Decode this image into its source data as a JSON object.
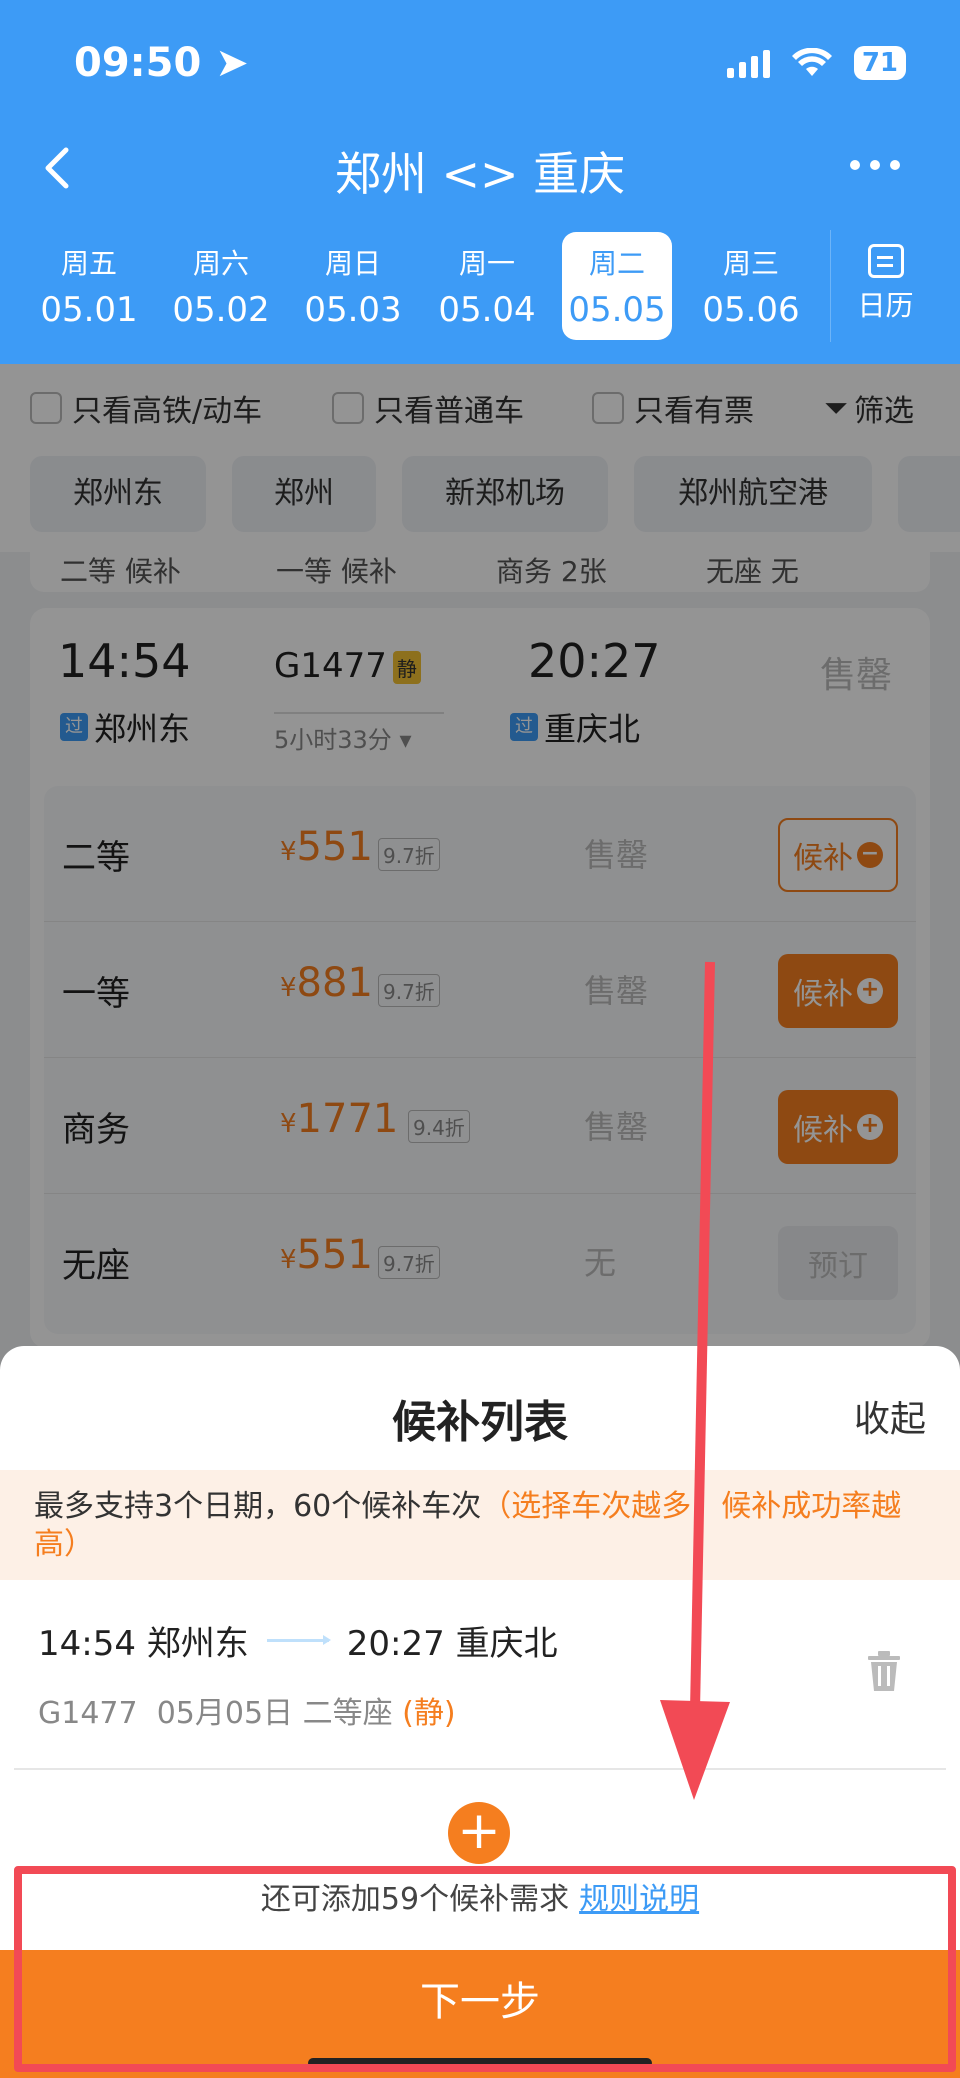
{
  "status_bar": {
    "time": "09:50",
    "battery": "71"
  },
  "nav": {
    "title": "郑州 <> 重庆"
  },
  "dates": [
    {
      "dow": "周五",
      "date": "05.01",
      "active": false
    },
    {
      "dow": "周六",
      "date": "05.02",
      "active": false
    },
    {
      "dow": "周日",
      "date": "05.03",
      "active": false
    },
    {
      "dow": "周一",
      "date": "05.04",
      "active": false
    },
    {
      "dow": "周二",
      "date": "05.05",
      "active": true
    },
    {
      "dow": "周三",
      "date": "05.06",
      "active": false
    }
  ],
  "calendar_label": "日历",
  "filters": {
    "high_speed": "只看高铁/动车",
    "normal": "只看普通车",
    "available": "只看有票",
    "screen": "筛选"
  },
  "stations": [
    "郑州东",
    "郑州",
    "新郑机场",
    "郑州航空港"
  ],
  "prev_card": {
    "c1": "二等 候补",
    "c2": "一等 候补",
    "c3": "商务 2张",
    "c4": "无座 无"
  },
  "train": {
    "depart_time": "14:54",
    "depart_station": "郑州东",
    "train_no": "G1477",
    "quiet_tag": "静",
    "duration": "5小时33分",
    "arrive_time": "20:27",
    "arrive_station": "重庆北",
    "pass_tag": "过",
    "status": "售罄",
    "seats": [
      {
        "name": "二等",
        "price": "551",
        "discount": "9.7折",
        "status": "售罄",
        "action": "候补"
      },
      {
        "name": "一等",
        "price": "881",
        "discount": "9.7折",
        "status": "售罄",
        "action": "候补"
      },
      {
        "name": "商务",
        "price": "1771",
        "discount": "9.4折",
        "status": "售罄",
        "action": "候补"
      },
      {
        "name": "无座",
        "price": "551",
        "discount": "9.7折",
        "status": "无",
        "action": "预订"
      }
    ]
  },
  "sheet": {
    "title": "候补列表",
    "collapse": "收起",
    "notice_plain": "最多支持3个日期，60个候补车次",
    "notice_highlight": "（选择车次越多，候补成功率越高）",
    "item_depart": "14:54 郑州东",
    "item_arrive": "20:27 重庆北",
    "item_train": "G1477",
    "item_date_seat": "05月05日 二等座",
    "item_quiet": "(静)",
    "add_hint": "还可添加59个候补需求",
    "rules_link": "规则说明",
    "next_button": "下一步"
  },
  "colors": {
    "header_blue": "#3d9bf6",
    "accent_orange": "#f57e1f",
    "annotation_red": "#f24a55"
  }
}
